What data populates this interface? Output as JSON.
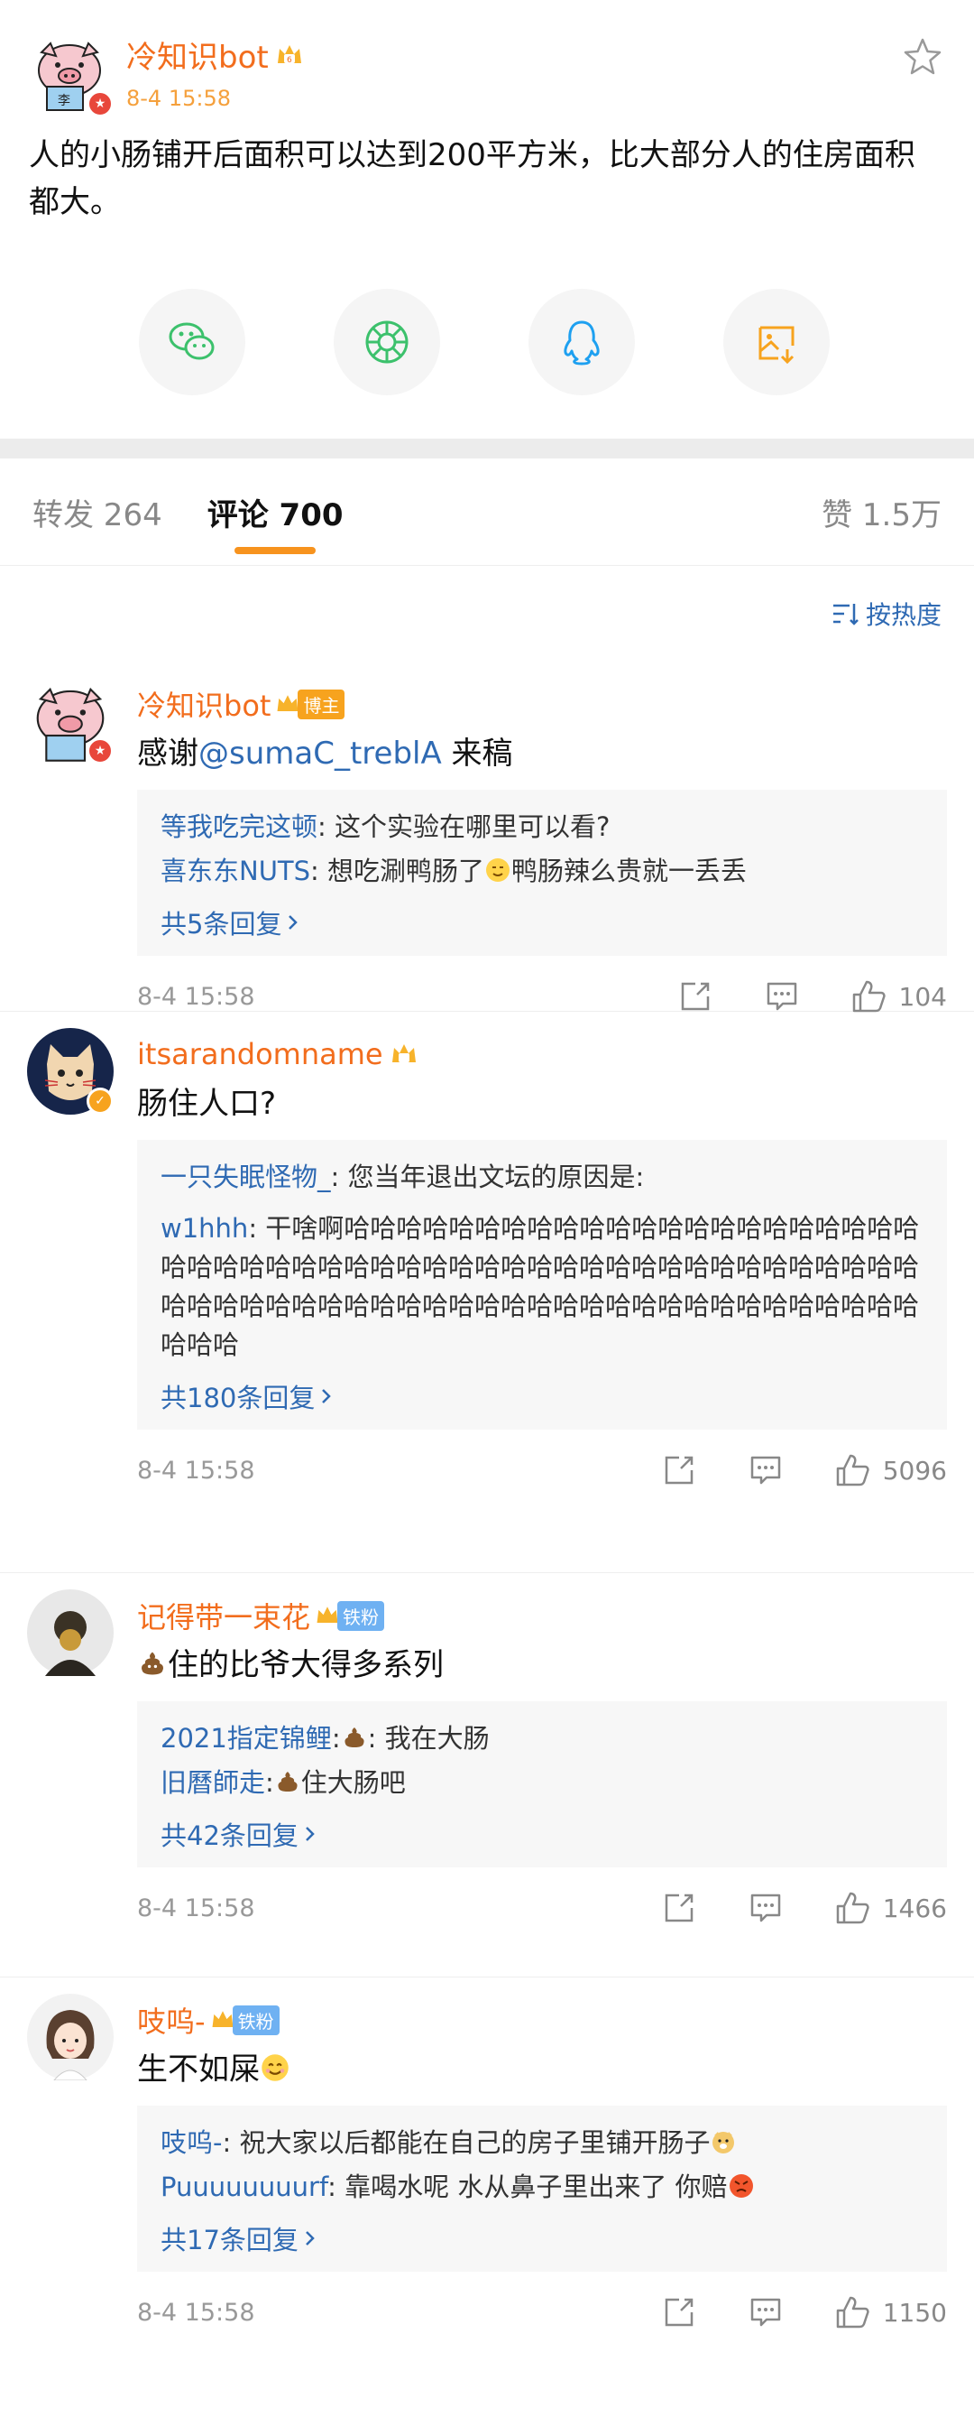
{
  "post": {
    "author": "冷知识bot",
    "time": "8-4 15:58",
    "text": "人的小肠铺开后面积可以达到200平方米，比大部分人的住房面积都大。"
  },
  "tabs": {
    "repost": "转发 264",
    "comments": "评论 700",
    "likes": "赞 1.5万"
  },
  "sort_label": "按热度",
  "comments": [
    {
      "name": "冷知识bot",
      "tag": "博主",
      "text_prefix": "感谢",
      "mention": "@sumaC_treblA",
      "text_suffix": " 来稿",
      "replies": [
        {
          "name": "等我吃完这顿",
          "text": ": 这个实验在哪里可以看?"
        },
        {
          "name": "喜东东NUTS",
          "text": ": 想吃涮鸭肠了",
          "text2": "鸭肠辣么贵就一丢丢"
        }
      ],
      "more": "共5条回复",
      "time": "8-4 15:58",
      "likes": "104"
    },
    {
      "name": "itsarandomname",
      "text": "肠住人口?",
      "replies": [
        {
          "name": "一只失眠怪物_",
          "text": ": 您当年退出文坛的原因是:"
        },
        {
          "name": "w1hhh",
          "text": ": 干啥啊哈哈哈哈哈哈哈哈哈哈哈哈哈哈哈哈哈哈哈哈哈哈哈哈哈哈哈哈哈哈哈哈哈哈哈哈哈哈哈哈哈哈哈哈哈哈哈哈哈哈哈哈哈哈哈哈哈哈哈哈哈哈哈哈哈哈哈哈哈哈哈哈哈哈哈哈哈哈哈哈哈哈哈"
        }
      ],
      "more": "共180条回复",
      "time": "8-4 15:58",
      "likes": "5096"
    },
    {
      "name": "记得带一束花",
      "tag": "铁粉",
      "text": "住的比爷大得多系列",
      "replies": [
        {
          "name": "2021指定锦鲤",
          "text": ":",
          "text2": ":  我在大肠"
        },
        {
          "name": "旧曆師走",
          "text": ":",
          "text2": "住大肠吧"
        }
      ],
      "more": "共42条回复",
      "time": "8-4 15:58",
      "likes": "1466"
    },
    {
      "name": "吱呜-",
      "tag": "铁粉",
      "text": "生不如屎",
      "replies": [
        {
          "name": "吱呜-",
          "text": ": 祝大家以后都能在自己的房子里铺开肠子"
        },
        {
          "name": "Puuuuuuuurf",
          "text": ": 靠喝水呢 水从鼻子里出来了 你赔"
        }
      ],
      "more": "共17条回复",
      "time": "8-4 15:58",
      "likes": "1150"
    }
  ],
  "icons": {
    "share": [
      "wechat-icon",
      "moments-icon",
      "qq-icon",
      "save-image-icon"
    ],
    "comment_actions": [
      "repost-icon",
      "reply-icon",
      "like-icon"
    ]
  },
  "colors": {
    "name_orange": "#f26d1d",
    "link_blue": "#2f6ab3",
    "tab_underline": "#f7931e",
    "reply_bg": "#f7f7f7"
  }
}
